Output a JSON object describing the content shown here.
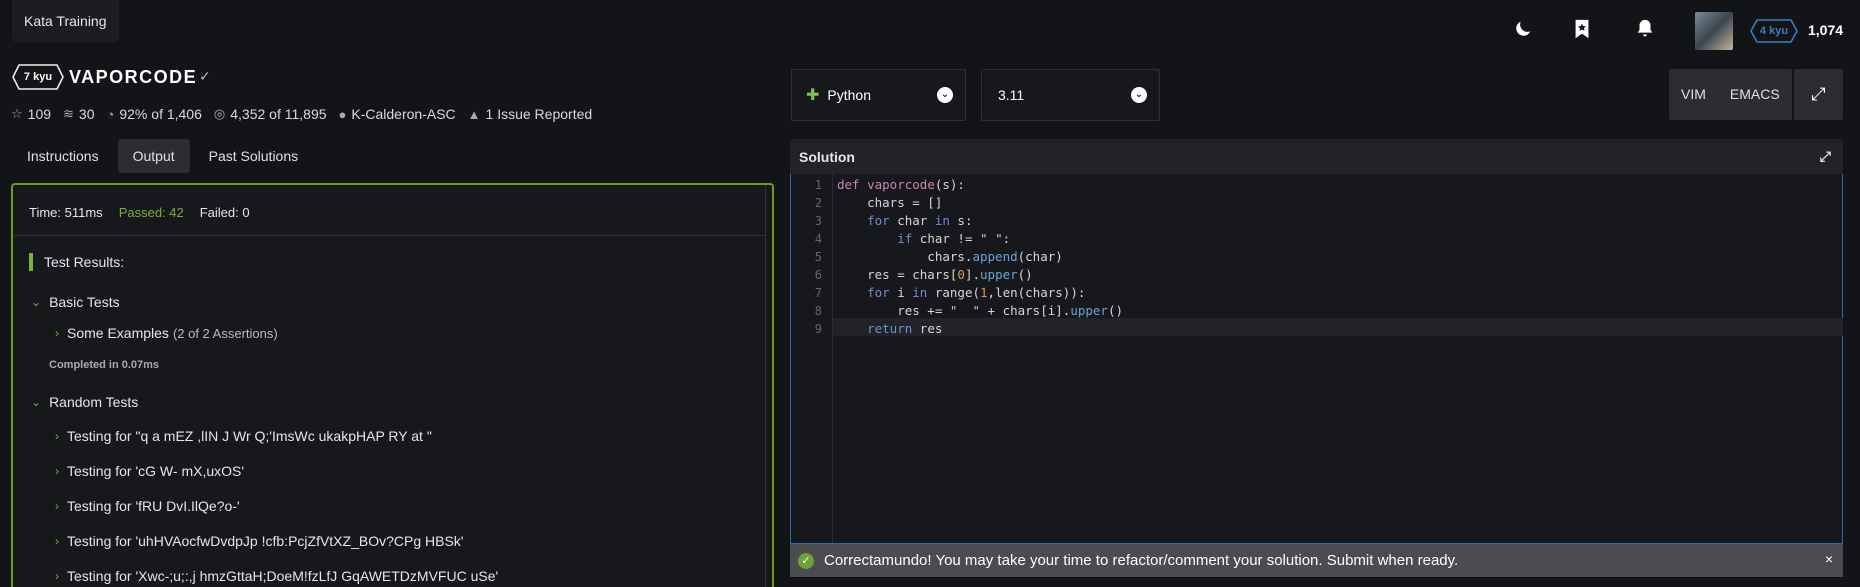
{
  "topbar": {
    "section_tab": "Kata Training",
    "rank": "4 kyu",
    "honor": "1,074"
  },
  "kata": {
    "kyu": "7 kyu",
    "title": "VAPORCODE",
    "stats": {
      "stars": "109",
      "collections": "30",
      "satisfaction": "92%",
      "satisfaction_of": "of 1,406",
      "completed": "4,352",
      "completed_of": "of 11,895",
      "author": "K-Calderon-ASC",
      "issues": "1 Issue Reported"
    }
  },
  "tabs": [
    "Instructions",
    "Output",
    "Past Solutions"
  ],
  "output": {
    "time": "Time: 511ms",
    "passed": "Passed: 42",
    "failed": "Failed: 0",
    "results_title": "Test Results:",
    "basic_group": "Basic Tests",
    "basic_item": "Some Examples",
    "basic_assertions": "(2 of 2 Assertions)",
    "completed_in": "Completed in 0.07ms",
    "random_group": "Random Tests",
    "random_items": [
      "Testing for \"q a mEZ  ,lIN J Wr Q;'ImsWc ukakpHAP RY at \"",
      "Testing for 'cG W- mX,uxOS'",
      "Testing for 'fRU DvI.IlQe?o-'",
      "Testing for 'uhHVAocfwDvdpJp !cfb:PcjZfVtXZ_BOv?CPg HBSk'",
      "Testing for 'Xwc-;u;:,j hmzGttaH;DoeM!fzLfJ GqAWETDzMVFUC uSe'"
    ]
  },
  "editor_toolbar": {
    "language": "Python",
    "version": "3.11",
    "vim": "VIM",
    "emacs": "EMACS"
  },
  "solution": {
    "header": "Solution",
    "line_numbers": [
      "1",
      "2",
      "3",
      "4",
      "5",
      "6",
      "7",
      "8",
      "9"
    ]
  },
  "notification": {
    "message": "Correctamundo! You may take your time to refactor/comment your solution. Submit when ready.",
    "close": "×"
  },
  "colors": {
    "success_green": "#79b13b",
    "editor_border": "#2a6db0",
    "rank_blue": "#3c7ebf"
  }
}
